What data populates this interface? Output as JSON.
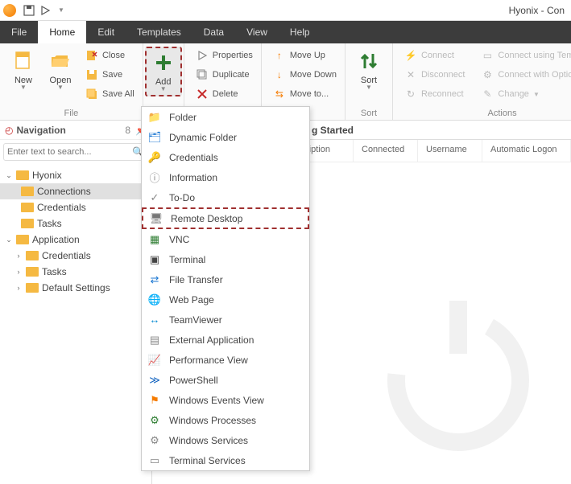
{
  "window": {
    "title": "Hyonix - Con"
  },
  "qat": {
    "save_icon": "save-icon",
    "play_icon": "play-icon"
  },
  "menubar": {
    "items": [
      "File",
      "Home",
      "Edit",
      "Templates",
      "Data",
      "View",
      "Help"
    ],
    "active_index": 1
  },
  "ribbon": {
    "groups": {
      "file": {
        "label": "File",
        "new": "New",
        "open": "Open",
        "close": "Close",
        "save": "Save",
        "save_all": "Save All"
      },
      "add": {
        "label": "",
        "add": "Add"
      },
      "clipboard": {
        "label": "",
        "properties": "Properties",
        "duplicate": "Duplicate",
        "delete": "Delete"
      },
      "move": {
        "label": "",
        "move_up": "Move Up",
        "move_down": "Move Down",
        "move_to": "Move to..."
      },
      "sort": {
        "label": "Sort",
        "sort": "Sort"
      },
      "actions": {
        "label": "Actions",
        "connect": "Connect",
        "disconnect": "Disconnect",
        "reconnect": "Reconnect",
        "connect_template": "Connect using Template",
        "connect_options": "Connect with Options",
        "change": "Change"
      }
    }
  },
  "nav": {
    "title": "Navigation",
    "count": "8",
    "search_placeholder": "Enter text to search...",
    "tree": {
      "root1": "Hyonix",
      "root1_children": [
        "Connections",
        "Credentials",
        "Tasks"
      ],
      "root2": "Application",
      "root2_children": [
        "Credentials",
        "Tasks",
        "Default Settings"
      ]
    }
  },
  "main": {
    "tab_title": "g Started",
    "columns": [
      "scription",
      "Connected",
      "Username",
      "Automatic Logon"
    ]
  },
  "dropdown": {
    "items": [
      {
        "label": "Folder",
        "icon": "folder-icon",
        "color": "#f5b942"
      },
      {
        "label": "Dynamic Folder",
        "icon": "dynamic-folder-icon",
        "color": "#1976d2"
      },
      {
        "label": "Credentials",
        "icon": "key-icon",
        "color": "#555"
      },
      {
        "label": "Information",
        "icon": "info-icon",
        "color": "#888"
      },
      {
        "label": "To-Do",
        "icon": "check-icon",
        "color": "#888"
      },
      {
        "label": "Remote Desktop",
        "icon": "remote-desktop-icon",
        "color": "#777"
      },
      {
        "label": "VNC",
        "icon": "vnc-icon",
        "color": "#2e7d32"
      },
      {
        "label": "Terminal",
        "icon": "terminal-icon",
        "color": "#444"
      },
      {
        "label": "File Transfer",
        "icon": "file-transfer-icon",
        "color": "#1976d2"
      },
      {
        "label": "Web Page",
        "icon": "globe-icon",
        "color": "#1976d2"
      },
      {
        "label": "TeamViewer",
        "icon": "teamviewer-icon",
        "color": "#0288d1"
      },
      {
        "label": "External Application",
        "icon": "app-icon",
        "color": "#888"
      },
      {
        "label": "Performance View",
        "icon": "performance-icon",
        "color": "#2e7d32"
      },
      {
        "label": "PowerShell",
        "icon": "powershell-icon",
        "color": "#1565c0"
      },
      {
        "label": "Windows Events View",
        "icon": "events-icon",
        "color": "#f57c00"
      },
      {
        "label": "Windows Processes",
        "icon": "processes-icon",
        "color": "#2e7d32"
      },
      {
        "label": "Windows Services",
        "icon": "services-icon",
        "color": "#888"
      },
      {
        "label": "Terminal Services",
        "icon": "terminal-services-icon",
        "color": "#888"
      }
    ],
    "highlighted_index": 5
  }
}
